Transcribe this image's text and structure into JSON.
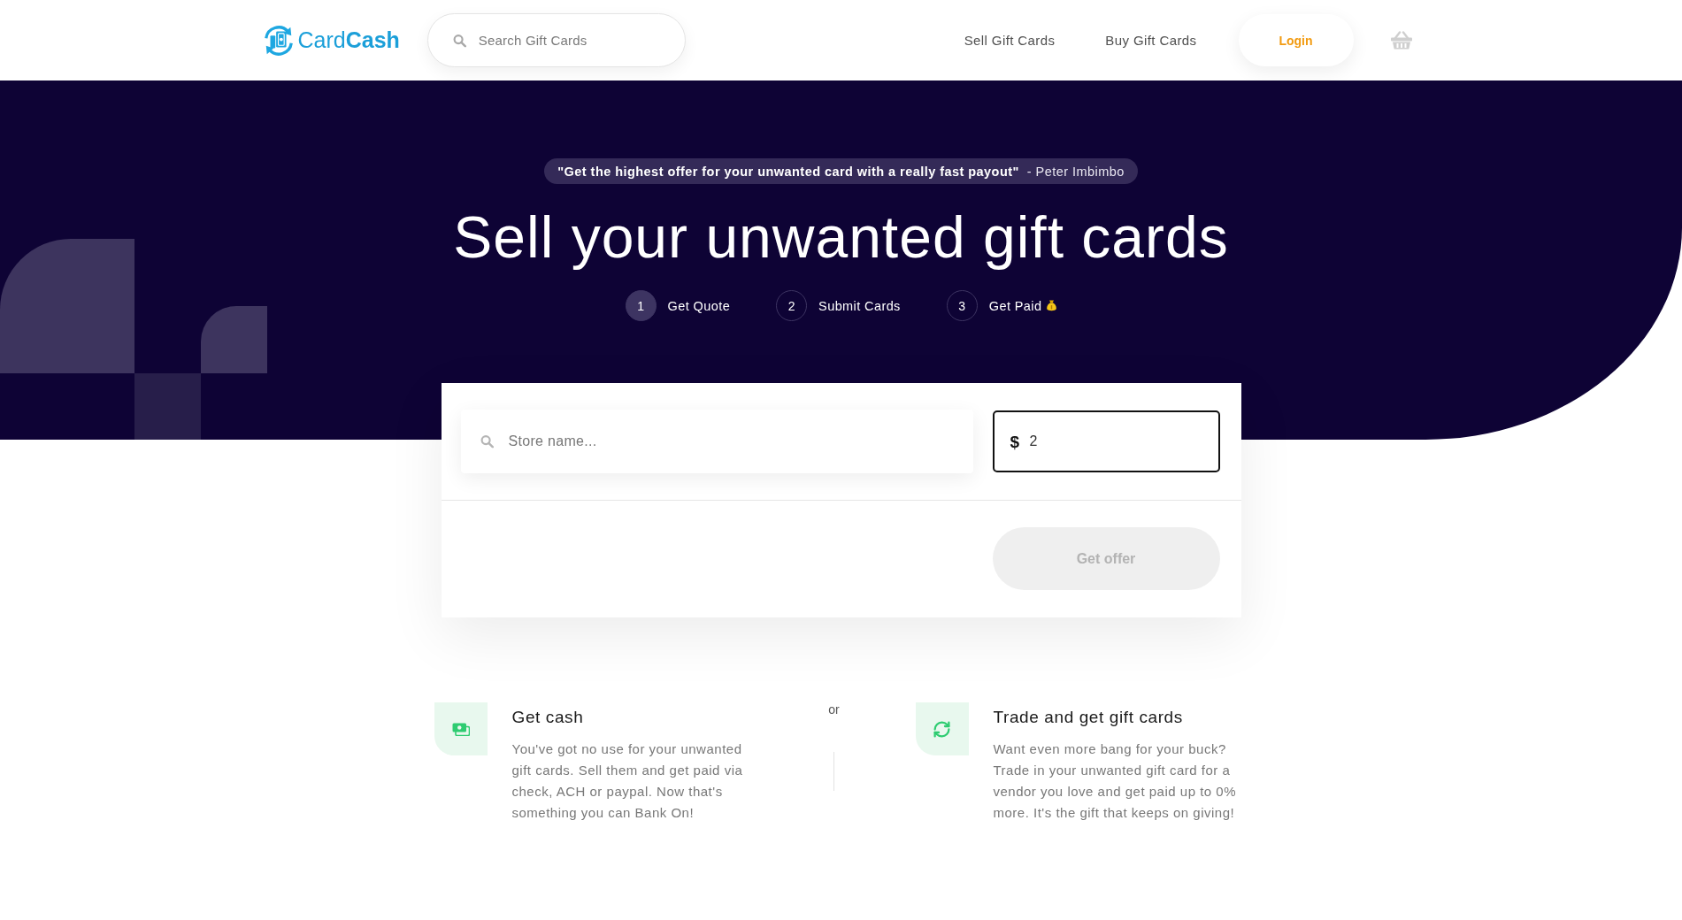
{
  "header": {
    "logo": "Card**Cash**",
    "search": {
      "placeholder": "Search Gift Cards"
    },
    "nav": [
      "Sell Gift Cards",
      "Buy Gift Cards"
    ],
    "login": "Login"
  },
  "hero": {
    "quote": "\"Get the highest offer for your unwanted card with a really fast payout\"",
    "author": "- Peter Imbimbo",
    "title": "Sell your unwanted gift cards",
    "steps": [
      {
        "number": "1",
        "label": "Get Quote",
        "current": true,
        "trailing_icon": false
      },
      {
        "number": "2",
        "label": "Submit Cards",
        "current": false,
        "trailing_icon": false
      },
      {
        "number": "3",
        "label": "Get Paid",
        "current": false,
        "trailing_icon": true
      }
    ]
  },
  "offer_form": {
    "store": {
      "placeholder": "Store name..."
    },
    "amount": {
      "currency": "$",
      "value": "2",
      "focused": true
    },
    "submit": {
      "label": "Get offer",
      "disabled": true
    }
  },
  "options": [
    {
      "kind": "cash",
      "title": "Get cash",
      "text": "You've got no use for your unwanted gift cards. Sell them and get paid via check, ACH or paypal. Now that's something you can Bank On!"
    },
    {
      "kind": "trade",
      "title": "Trade and get gift cards",
      "text": "Want even more bang for your buck? Trade in your unwanted gift card for a vendor you love and get paid up to 0% more. It's the gift that keeps on giving!"
    }
  ],
  "separator": "or"
}
